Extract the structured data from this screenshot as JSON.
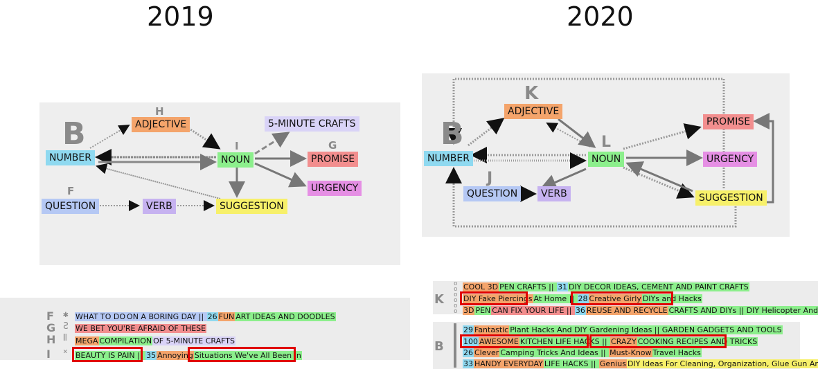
{
  "years": {
    "left": "2019",
    "right": "2020"
  },
  "diagram2019": {
    "letters": {
      "B": "B",
      "H": "H",
      "I": "I",
      "F": "F",
      "G": "G"
    },
    "nodes": {
      "number": "NUMBER",
      "adjective": "ADJECTIVE",
      "noun": "NOUN",
      "crafts": "5-MINUTE CRAFTS",
      "promise": "PROMISE",
      "urgency": "URGENCY",
      "question": "QUESTION",
      "verb": "VERB",
      "suggestion": "SUGGESTION"
    }
  },
  "diagram2020": {
    "letters": {
      "K": "K",
      "B": "B",
      "L": "L",
      "J": "J"
    },
    "nodes": {
      "adjective": "ADJECTIVE",
      "number": "NUMBER",
      "noun": "NOUN",
      "promise": "PROMISE",
      "urgency": "URGENCY",
      "question": "QUESTION",
      "verb": "VERB",
      "suggestion": "SUGGESTION"
    }
  },
  "examples2019": {
    "letters": [
      "F",
      "G",
      "H",
      "I"
    ],
    "lines": [
      [
        {
          "t": "WHAT TO DO",
          "c": "per"
        },
        {
          "t": "ON A BORING DAY || ",
          "c": "per"
        },
        {
          "t": "26",
          "c": "blue"
        },
        {
          "t": "FUN",
          "c": "org"
        },
        {
          "t": "ART IDEAS AND DOODLES",
          "c": "grn"
        }
      ],
      [
        {
          "t": "WE BET YOU'RE AFRAID OF THESE",
          "c": "red"
        }
      ],
      [
        {
          "t": "MEGA",
          "c": "org"
        },
        {
          "t": "COMPILATION",
          "c": "grn"
        },
        {
          "t": "OF 5-MINUTE CRAFTS",
          "c": "lav"
        }
      ],
      [
        {
          "t": "BEAUTY IS PAIN || ",
          "c": "grn"
        },
        {
          "t": "35",
          "c": "blue"
        },
        {
          "t": "Annoying",
          "c": "org"
        },
        {
          "t": "Situations We've All Been In",
          "c": "grn"
        }
      ]
    ]
  },
  "examples2020k": {
    "letter": "K",
    "lines": [
      [
        {
          "t": "COOL 3D",
          "c": "org"
        },
        {
          "t": "PEN CRAFTS || ",
          "c": "grn"
        },
        {
          "t": "31",
          "c": "blue"
        },
        {
          "t": "DIY DECOR IDEAS, CEMENT AND PAINT CRAFTS",
          "c": "grn"
        }
      ],
      [
        {
          "t": "DIY Fake Piercings",
          "c": "org"
        },
        {
          "t": "At Home || ",
          "c": "grn"
        },
        {
          "t": "28",
          "c": "blue"
        },
        {
          "t": "Creative Girly",
          "c": "org"
        },
        {
          "t": "DIYs and Hacks",
          "c": "grn"
        }
      ],
      [
        {
          "t": "3D",
          "c": "org"
        },
        {
          "t": "PEN",
          "c": "grn"
        },
        {
          "t": "CAN FIX YOUR LIFE || ",
          "c": "red"
        },
        {
          "t": "36",
          "c": "blue"
        },
        {
          "t": "REUSE AND RECYCLE",
          "c": "org"
        },
        {
          "t": "CRAFTS AND DIYs || DIY Helicopter And BBQ Grill",
          "c": "grn"
        }
      ]
    ]
  },
  "examples2020b": {
    "letter": "B",
    "lines": [
      [
        {
          "t": "29",
          "c": "blue"
        },
        {
          "t": "Fantastic",
          "c": "org"
        },
        {
          "t": "Plant Hacks And DIY Gardening Ideas || GARDEN GADGETS AND TOOLS",
          "c": "grn"
        }
      ],
      [
        {
          "t": "100",
          "c": "blue"
        },
        {
          "t": "AWESOME",
          "c": "org"
        },
        {
          "t": "KITCHEN LIFE HACKS || ",
          "c": "grn"
        },
        {
          "t": "CRAZY",
          "c": "org"
        },
        {
          "t": "COOKING RECIPES AND TRICKS",
          "c": "grn"
        }
      ],
      [
        {
          "t": "26",
          "c": "blue"
        },
        {
          "t": "Clever",
          "c": "org"
        },
        {
          "t": "Camping Tricks And Ideas || ",
          "c": "grn"
        },
        {
          "t": "Must-Know",
          "c": "org"
        },
        {
          "t": "Travel Hacks",
          "c": "grn"
        }
      ],
      [
        {
          "t": "33",
          "c": "blue"
        },
        {
          "t": "HANDY EVERYDAY",
          "c": "org"
        },
        {
          "t": "LIFE HACKS || ",
          "c": "grn"
        },
        {
          "t": "Genius",
          "c": "org"
        },
        {
          "t": "DIY Ideas For Cleaning, Organization, Glue Gun And Slime",
          "c": "yel"
        }
      ]
    ]
  },
  "colors": {
    "blue": "#8fd9f0",
    "org": "#f4a46b",
    "grn": "#8cef8c",
    "pur": "#c6b2f0",
    "red": "#f28e8e",
    "mag": "#e58fe4",
    "yel": "#f7f06a",
    "per": "#b5c8f4",
    "lav": "#d9d3f7",
    "highlight": "#e00000"
  }
}
